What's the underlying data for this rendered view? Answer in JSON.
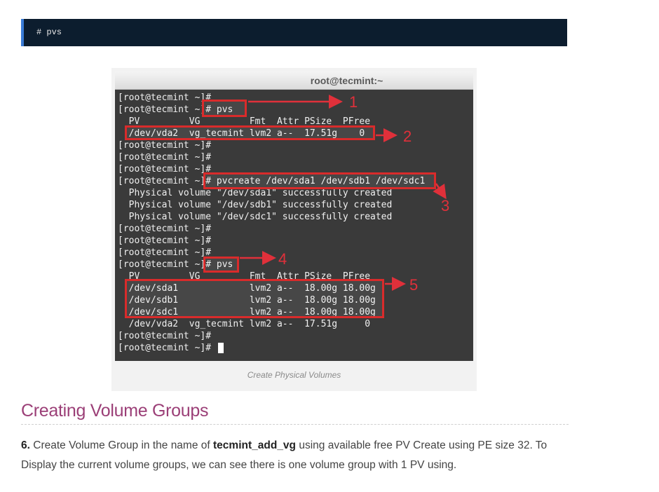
{
  "code_block": {
    "command": "# pvs"
  },
  "figure": {
    "terminal": {
      "window_title": "root@tecmint:~",
      "lines": [
        "[root@tecmint ~]#",
        "[root@tecmint ~]# pvs",
        "  PV         VG         Fmt  Attr PSize  PFree",
        "  /dev/vda2  vg_tecmint lvm2 a--  17.51g    0",
        "[root@tecmint ~]#",
        "[root@tecmint ~]#",
        "[root@tecmint ~]#",
        "[root@tecmint ~]# pvcreate /dev/sda1 /dev/sdb1 /dev/sdc1",
        "  Physical volume \"/dev/sda1\" successfully created",
        "  Physical volume \"/dev/sdb1\" successfully created",
        "  Physical volume \"/dev/sdc1\" successfully created",
        "[root@tecmint ~]#",
        "[root@tecmint ~]#",
        "[root@tecmint ~]#",
        "[root@tecmint ~]# pvs",
        "  PV         VG         Fmt  Attr PSize  PFree",
        "  /dev/sda1             lvm2 a--  18.00g 18.00g",
        "  /dev/sdb1             lvm2 a--  18.00g 18.00g",
        "  /dev/sdc1             lvm2 a--  18.00g 18.00g",
        "  /dev/vda2  vg_tecmint lvm2 a--  17.51g     0",
        "[root@tecmint ~]#",
        "[root@tecmint ~]# "
      ],
      "annotations": [
        "1",
        "2",
        "3",
        "4",
        "5"
      ],
      "annotation_color": "#e0303a"
    },
    "caption": "Create Physical Volumes"
  },
  "section": {
    "heading": "Creating Volume Groups",
    "step_number": "6.",
    "text_before": " Create Volume Group in the name of ",
    "vg_name": "tecmint_add_vg",
    "text_after": " using available free PV Create using PE size 32. To Display the current volume groups, we can see there is one volume group with 1 PV using."
  }
}
